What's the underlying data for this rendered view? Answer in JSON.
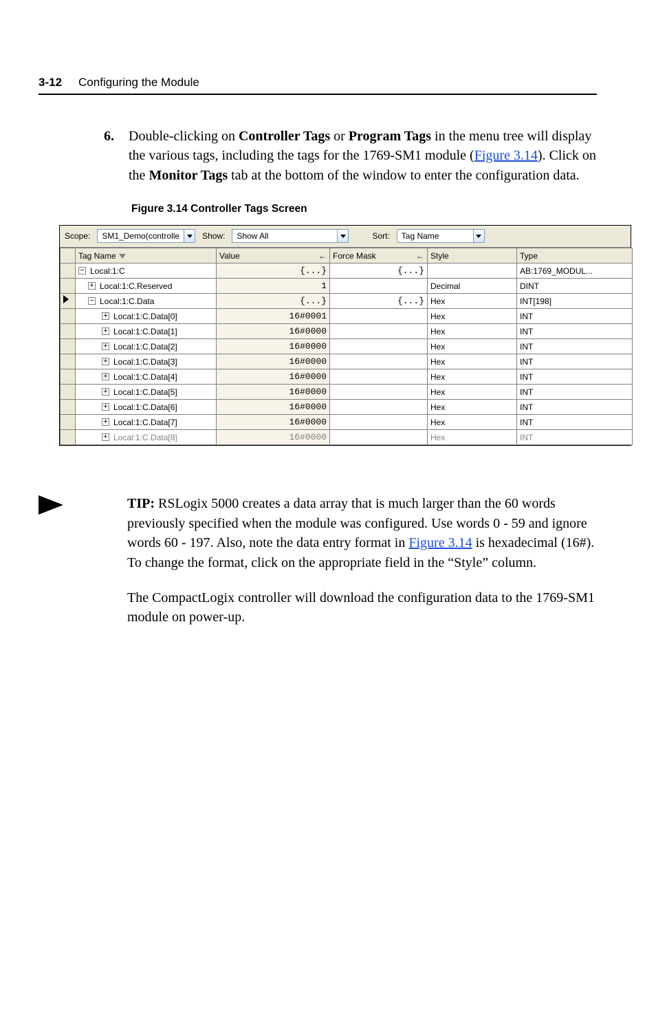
{
  "header": {
    "page_no": "3-12",
    "title": "Configuring the Module"
  },
  "step": {
    "number": "6.",
    "pre": "Double-clicking on ",
    "bold1": "Controller Tags",
    "mid1": " or ",
    "bold2": "Program Tags",
    "mid2": " in the menu tree will display the various tags, including the tags for the 1769-SM1 module (",
    "link1": "Figure 3.14",
    "mid3": "). Click on the ",
    "bold3": "Monitor Tags",
    "post": " tab at the bottom of the window to enter the configuration data."
  },
  "figcaption": "Figure 3.14   Controller Tags Screen",
  "shot": {
    "labels": {
      "scope": "Scope:",
      "show": "Show:",
      "sort": "Sort:"
    },
    "scope_value": "SM1_Demo(controlle",
    "show_value": "Show All",
    "sort_value": "Tag Name",
    "columns": {
      "tag": "Tag Name",
      "value": "Value",
      "mask": "Force Mask",
      "style": "Style",
      "type": "Type"
    },
    "arrows": {
      "value": "←",
      "mask": "←"
    },
    "rows": [
      {
        "sel": false,
        "indent": 0,
        "expand": "−",
        "name": "Local:1:C",
        "value": "{...}",
        "mask": "{...}",
        "style": "",
        "type": "AB:1769_MODUL..."
      },
      {
        "sel": false,
        "indent": 1,
        "expand": "+",
        "name": "Local:1:C.Reserved",
        "value": "1",
        "mask": "",
        "style": "Decimal",
        "type": "DINT"
      },
      {
        "sel": true,
        "indent": 1,
        "expand": "−",
        "name": "Local:1:C.Data",
        "value": "{...}",
        "mask": "{...}",
        "style": "Hex",
        "type": "INT[198]"
      },
      {
        "sel": false,
        "indent": 2,
        "expand": "+",
        "name": "Local:1:C.Data[0]",
        "value": "16#0001",
        "mask": "",
        "style": "Hex",
        "type": "INT"
      },
      {
        "sel": false,
        "indent": 2,
        "expand": "+",
        "name": "Local:1:C.Data[1]",
        "value": "16#0000",
        "mask": "",
        "style": "Hex",
        "type": "INT"
      },
      {
        "sel": false,
        "indent": 2,
        "expand": "+",
        "name": "Local:1:C.Data[2]",
        "value": "16#0000",
        "mask": "",
        "style": "Hex",
        "type": "INT"
      },
      {
        "sel": false,
        "indent": 2,
        "expand": "+",
        "name": "Local:1:C.Data[3]",
        "value": "16#0000",
        "mask": "",
        "style": "Hex",
        "type": "INT"
      },
      {
        "sel": false,
        "indent": 2,
        "expand": "+",
        "name": "Local:1:C.Data[4]",
        "value": "16#0000",
        "mask": "",
        "style": "Hex",
        "type": "INT"
      },
      {
        "sel": false,
        "indent": 2,
        "expand": "+",
        "name": "Local:1:C.Data[5]",
        "value": "16#0000",
        "mask": "",
        "style": "Hex",
        "type": "INT"
      },
      {
        "sel": false,
        "indent": 2,
        "expand": "+",
        "name": "Local:1:C.Data[6]",
        "value": "16#0000",
        "mask": "",
        "style": "Hex",
        "type": "INT"
      },
      {
        "sel": false,
        "indent": 2,
        "expand": "+",
        "name": "Local:1:C.Data[7]",
        "value": "16#0000",
        "mask": "",
        "style": "Hex",
        "type": "INT"
      },
      {
        "sel": false,
        "indent": 2,
        "expand": "+",
        "name": "Local:1:C.Data[8]",
        "value": "16#0000",
        "mask": "",
        "style": "Hex",
        "type": "INT",
        "cut": true
      }
    ]
  },
  "tip": {
    "label": "TIP:",
    "text1": "  RSLogix 5000 creates a data array that is much larger than the 60 words previously specified when the module was configured. Use words 0 - 59 and ignore words 60 - 197. Also, note the data entry format in ",
    "link": "Figure 3.14",
    "text2": " is hexadecimal (16#). To change the format, click on the appropriate field in the “Style” column."
  },
  "follow": "The CompactLogix controller will download the configuration data to the 1769-SM1 module on power-up."
}
